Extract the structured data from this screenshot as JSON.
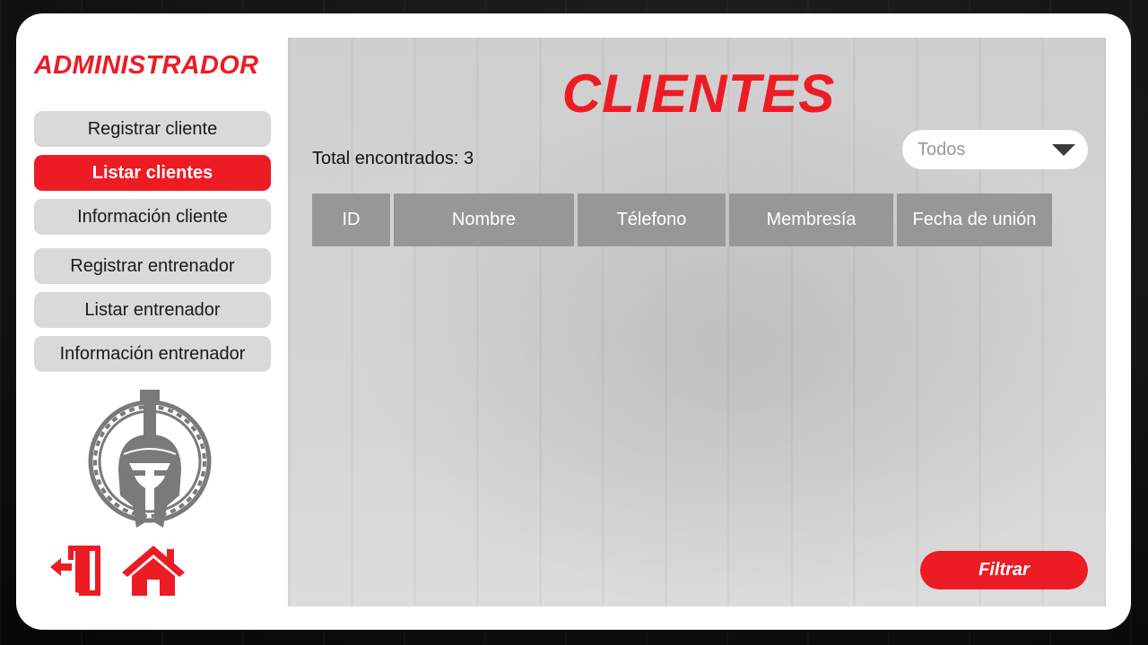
{
  "sidebar": {
    "title": "ADMINISTRADOR",
    "items": [
      {
        "label": "Registrar cliente",
        "active": false
      },
      {
        "label": "Listar clientes",
        "active": true
      },
      {
        "label": "Información cliente",
        "active": false
      },
      {
        "label": "Registrar entrenador",
        "active": false
      },
      {
        "label": "Listar entrenador",
        "active": false
      },
      {
        "label": "Información entrenador",
        "active": false
      }
    ],
    "logo_icon": "spartan-helmet-icon",
    "logout_icon": "logout-icon",
    "home_icon": "home-icon"
  },
  "main": {
    "title": "CLIENTES",
    "total_label": "Total encontrados: 3",
    "filter_select": {
      "value": "Todos",
      "icon": "chevron-down-icon"
    },
    "table": {
      "columns": [
        "ID",
        "Nombre",
        "Télefono",
        "Membresía",
        "Fecha de unión"
      ],
      "rows": []
    },
    "filter_button": "Filtrar"
  },
  "colors": {
    "accent": "#ed1c24",
    "nav_button": "#d9d9d9",
    "table_header": "#979797",
    "panel": "#d0d0d0",
    "logo_gray": "#7a7a7a"
  }
}
